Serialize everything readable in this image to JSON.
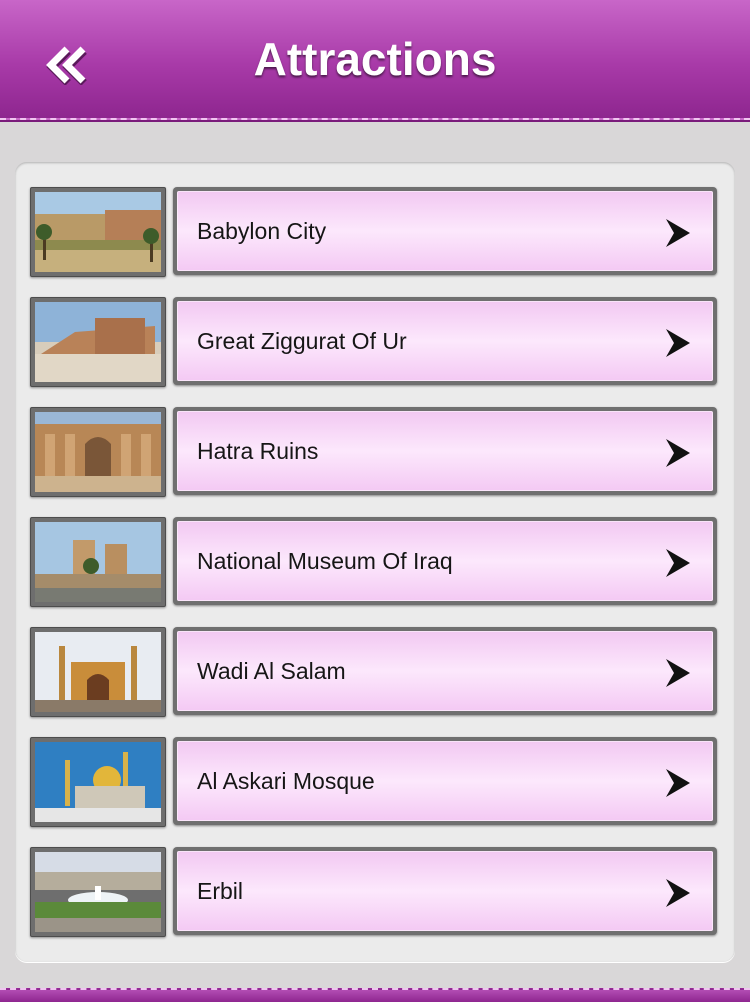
{
  "header": {
    "title": "Attractions",
    "back_icon": "double-chevron-left-icon",
    "bar_color": "#a83aa8"
  },
  "attractions": [
    {
      "label": "Babylon City",
      "icon": "chevron-right-icon"
    },
    {
      "label": "Great Ziggurat Of Ur",
      "icon": "chevron-right-icon"
    },
    {
      "label": "Hatra Ruins",
      "icon": "chevron-right-icon"
    },
    {
      "label": "National Museum Of Iraq",
      "icon": "chevron-right-icon"
    },
    {
      "label": "Wadi Al Salam",
      "icon": "chevron-right-icon"
    },
    {
      "label": "Al Askari Mosque",
      "icon": "chevron-right-icon"
    },
    {
      "label": "Erbil",
      "icon": "chevron-right-icon"
    }
  ],
  "colors": {
    "accent": "#a83aa8",
    "item_fill": "#f6d4f6",
    "background": "#d9d7d8"
  }
}
